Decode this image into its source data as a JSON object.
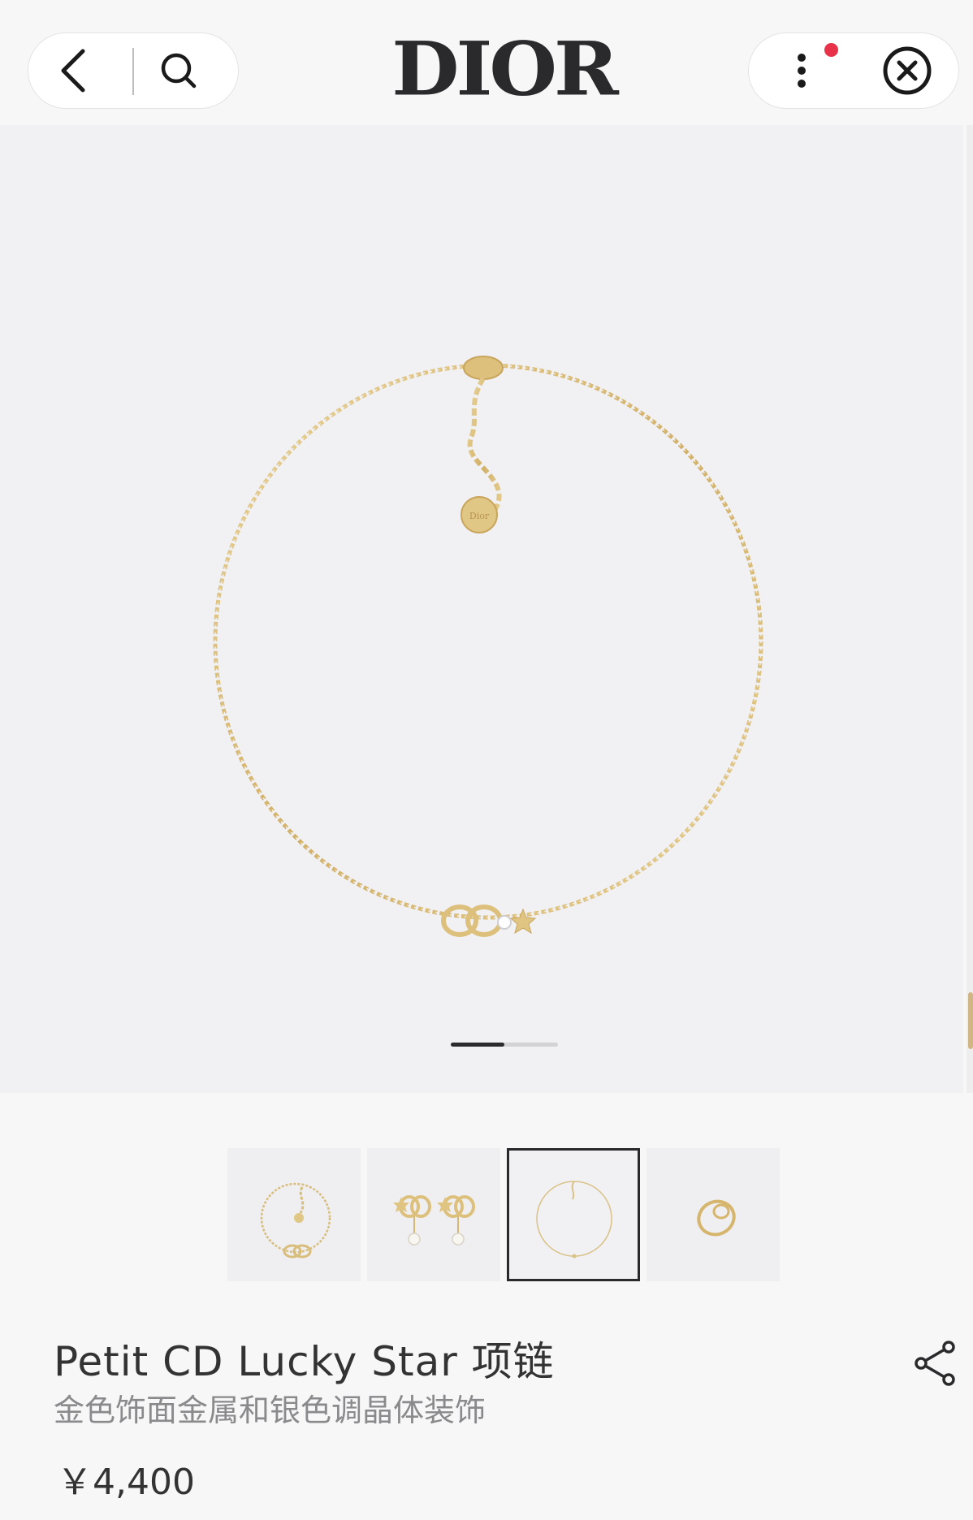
{
  "header": {
    "brand": "DIOR",
    "back_icon": "chevron-left-icon",
    "search_icon": "search-icon",
    "more_icon": "vertical-dots-icon",
    "close_icon": "close-circle-icon",
    "notification_color": "#e8324a"
  },
  "hero": {
    "carousel_progress": 0.5
  },
  "thumbnails": {
    "items": [
      {
        "name": "bracelet-thumbnail",
        "selected": false
      },
      {
        "name": "earrings-thumbnail",
        "selected": false
      },
      {
        "name": "necklace-thumbnail",
        "selected": true
      },
      {
        "name": "ring-thumbnail",
        "selected": false
      }
    ]
  },
  "product": {
    "title": "Petit CD Lucky Star 项链",
    "subtitle": "金色饰面金属和银色调晶体装饰",
    "price": "￥4,400",
    "share_icon": "share-icon"
  },
  "colors": {
    "gold": "#d7b871",
    "background": "#f1f0f3",
    "text": "#333333"
  }
}
